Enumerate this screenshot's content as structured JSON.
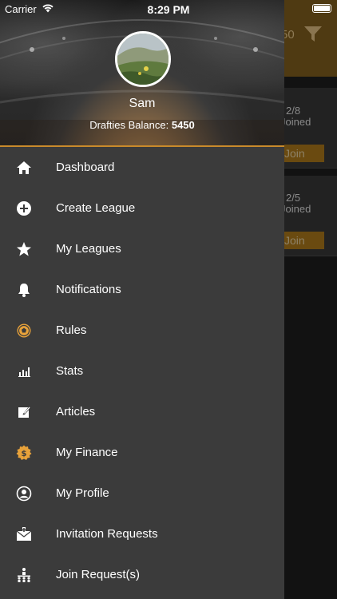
{
  "status": {
    "carrier": "Carrier",
    "time": "8:29 PM"
  },
  "background": {
    "filter_value": "50",
    "cards": [
      {
        "count": "2/8",
        "joined": "Joined",
        "join_label": "Join"
      },
      {
        "count": "2/5",
        "joined": "Joined",
        "join_label": "Join"
      }
    ]
  },
  "drawer": {
    "user_name": "Sam",
    "balance_label": "Drafties Balance:",
    "balance_value": "5450",
    "menu": [
      {
        "label": "Dashboard",
        "icon": "home-icon"
      },
      {
        "label": "Create League",
        "icon": "plus-circle-icon"
      },
      {
        "label": "My Leagues",
        "icon": "star-icon"
      },
      {
        "label": "Notifications",
        "icon": "bell-icon"
      },
      {
        "label": "Rules",
        "icon": "soccer-ball-icon"
      },
      {
        "label": "Stats",
        "icon": "bar-chart-icon"
      },
      {
        "label": "Articles",
        "icon": "edit-icon"
      },
      {
        "label": "My Finance",
        "icon": "dollar-badge-icon"
      },
      {
        "label": "My Profile",
        "icon": "user-circle-icon"
      },
      {
        "label": "Invitation Requests",
        "icon": "envelope-plus-icon"
      },
      {
        "label": "Join Request(s)",
        "icon": "team-icon"
      }
    ]
  }
}
